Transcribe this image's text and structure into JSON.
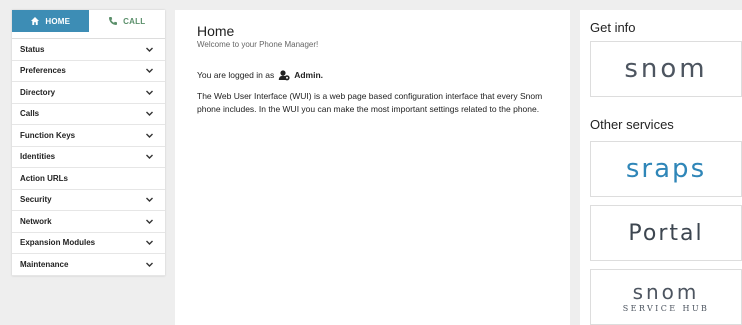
{
  "tabs": [
    {
      "label": "HOME",
      "icon": "home-icon"
    },
    {
      "label": "CALL",
      "icon": "phone-icon"
    }
  ],
  "menu": [
    {
      "label": "Status",
      "expandable": true
    },
    {
      "label": "Preferences",
      "expandable": true
    },
    {
      "label": "Directory",
      "expandable": true
    },
    {
      "label": "Calls",
      "expandable": true
    },
    {
      "label": "Function Keys",
      "expandable": true
    },
    {
      "label": "Identities",
      "expandable": true
    },
    {
      "label": "Action URLs",
      "expandable": false
    },
    {
      "label": "Security",
      "expandable": true
    },
    {
      "label": "Network",
      "expandable": true
    },
    {
      "label": "Expansion Modules",
      "expandable": true
    },
    {
      "label": "Maintenance",
      "expandable": true
    }
  ],
  "main": {
    "title": "Home",
    "subtitle": "Welcome to your Phone Manager!",
    "logged_prefix": "You are logged in as",
    "user": "Admin.",
    "description": "The Web User Interface (WUI) is a web page based configuration interface that every Snom phone includes. In the WUI you can make the most important settings related to the phone."
  },
  "right": {
    "get_info": "Get info",
    "other_services": "Other services",
    "logos": {
      "snom": "snom",
      "sraps": "sraps",
      "portal": "Portal",
      "hub_main": "snom",
      "hub_sub": "SERVICE HUB"
    }
  },
  "colors": {
    "accent": "#3d8db5",
    "call_tab_text": "#5a8f6a",
    "sraps_blue": "#2f86b8"
  }
}
